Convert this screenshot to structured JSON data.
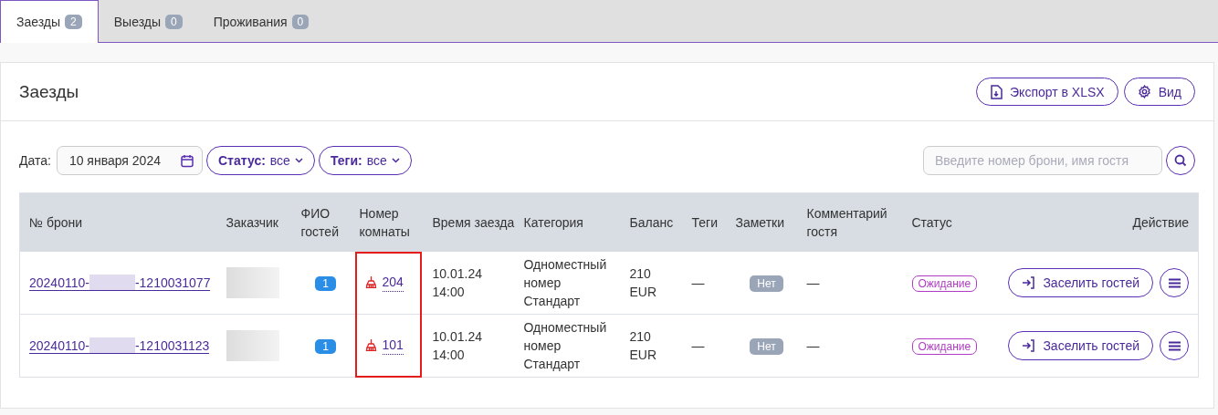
{
  "tabs": [
    {
      "label": "Заезды",
      "count": "2",
      "selected": true
    },
    {
      "label": "Выезды",
      "count": "0",
      "selected": false
    },
    {
      "label": "Проживания",
      "count": "0",
      "selected": false
    }
  ],
  "panel": {
    "title": "Заезды",
    "buttons": [
      {
        "kind": "export",
        "label": "Экспорт в XLSX"
      },
      {
        "kind": "view",
        "label": "Вид"
      }
    ]
  },
  "filters": {
    "date_label": "Дата:",
    "date_value": "10 января 2024",
    "dropdowns": [
      {
        "label": "Статус:",
        "value": "все"
      },
      {
        "label": "Теги:",
        "value": "все"
      }
    ],
    "search_placeholder": "Введите номер брони, имя гостя"
  },
  "table": {
    "columns": [
      "№ брони",
      "Заказчик",
      "ФИО гостей",
      "Номер комнаты",
      "Время заезда",
      "Категория",
      "Баланс",
      "Теги",
      "Заметки",
      "Комментарий гостя",
      "Статус",
      "Действие"
    ],
    "rows": [
      {
        "booking_prefix": "20240110-",
        "booking_suffix": "-1210031077",
        "guests": "1",
        "room": "204",
        "room_framed": true,
        "needs_cleaning": true,
        "checkin": "10.01.24 14:00",
        "category": "Одноместный номер Стандарт",
        "balance": "210 EUR",
        "tags": "—",
        "notes": "Нет",
        "comment": "—",
        "status": "Ожидание",
        "action": "Заселить гостей"
      },
      {
        "booking_prefix": "20240110-",
        "booking_suffix": "-1210031123",
        "guests": "1",
        "room": "101",
        "room_framed": true,
        "needs_cleaning": true,
        "checkin": "10.01.24 14:00",
        "category": "Одноместный номер Стандарт",
        "balance": "210 EUR",
        "tags": "—",
        "notes": "Нет",
        "comment": "—",
        "status": "Ожидание",
        "action": "Заселить гостей"
      }
    ]
  }
}
